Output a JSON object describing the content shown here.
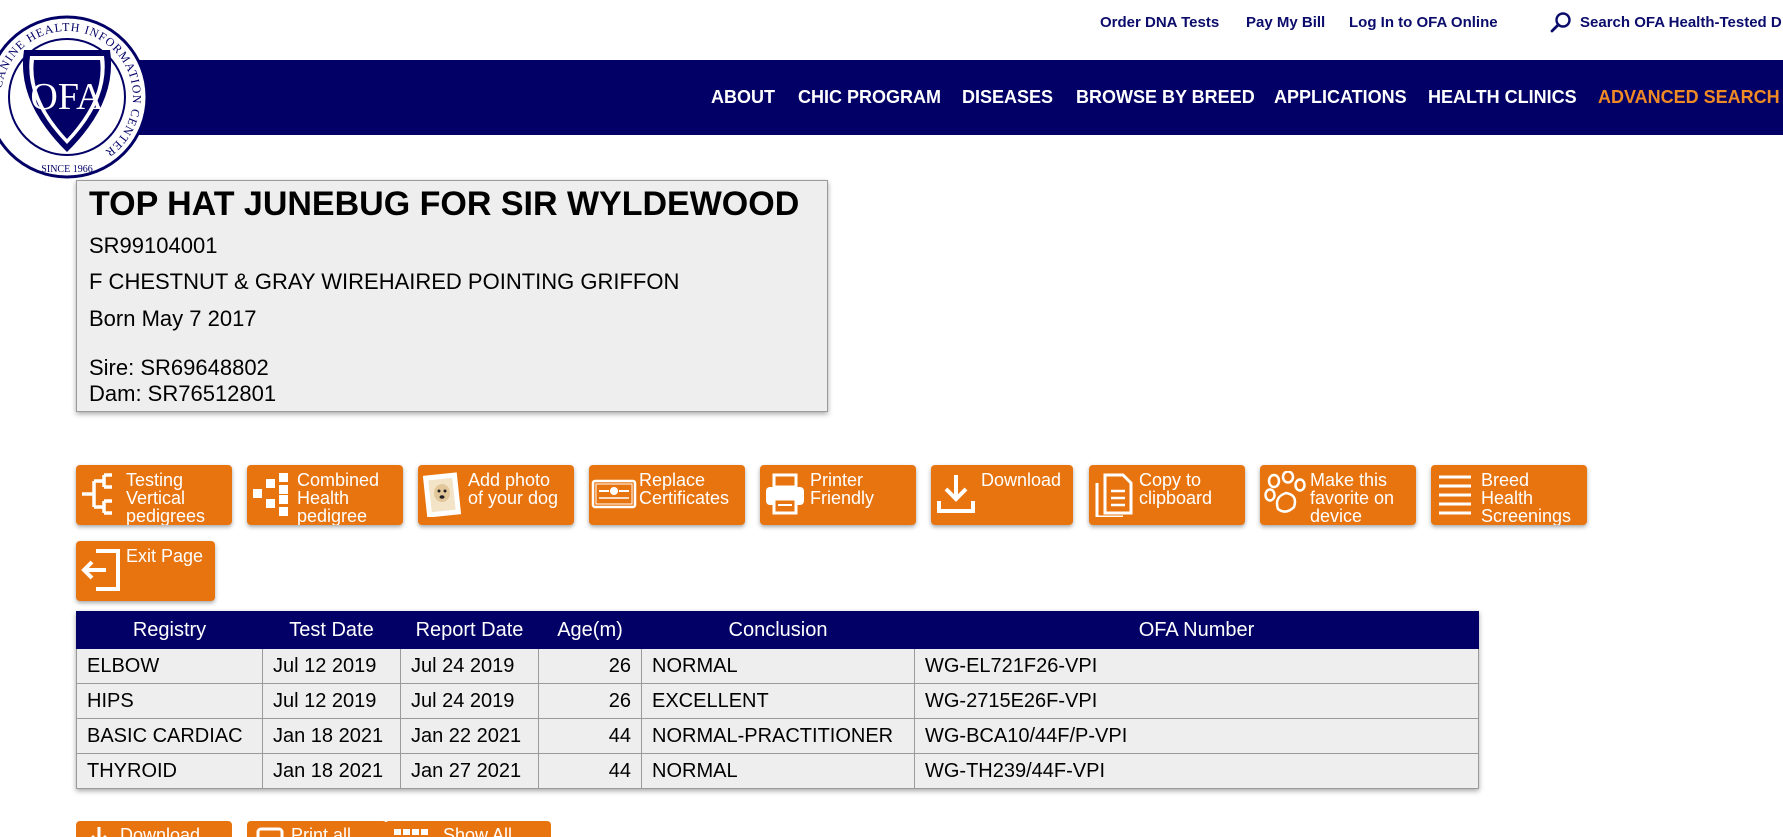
{
  "utility": {
    "order_dna": "Order DNA Tests",
    "pay_bill": "Pay My Bill",
    "login": "Log In to OFA Online",
    "search_label": "Search OFA Health-Tested D"
  },
  "logo": {
    "text": "OFA",
    "ring_text": "CANINE HEALTH INFORMATION CENTER",
    "since": "SINCE 1966"
  },
  "nav": {
    "items": [
      "ABOUT",
      "CHIC PROGRAM",
      "DISEASES",
      "BROWSE BY BREED",
      "APPLICATIONS",
      "HEALTH CLINICS",
      "ADVANCED SEARCH"
    ],
    "active": "ADVANCED SEARCH",
    "active_color": "#f08a24"
  },
  "dog": {
    "name": "TOP HAT JUNEBUG FOR SIR WYLDEWOOD",
    "registration": "SR99104001",
    "description": "F CHESTNUT & GRAY WIREHAIRED POINTING GRIFFON",
    "born": "Born May 7 2017",
    "sire": "Sire: SR69648802",
    "dam": "Dam: SR76512801"
  },
  "actions": [
    {
      "label": "Testing\nVertical\npedigrees",
      "icon": "pedigree-tree-icon"
    },
    {
      "label": "Combined\nHealth\npedigree",
      "icon": "combined-pedigree-icon"
    },
    {
      "label": "Add photo\nof your dog",
      "icon": "dog-photo-icon"
    },
    {
      "label": "Replace\nCertificates",
      "icon": "certificate-icon"
    },
    {
      "label": "Printer\nFriendly",
      "icon": "printer-icon"
    },
    {
      "label": "Download",
      "icon": "download-icon"
    },
    {
      "label": "Copy to\nclipboard",
      "icon": "clipboard-icon"
    },
    {
      "label": "Make this\nfavorite on\ndevice",
      "icon": "paw-icon"
    },
    {
      "label": "Breed\nHealth\nScreenings",
      "icon": "list-icon"
    },
    {
      "label": "Exit Page",
      "icon": "exit-icon"
    }
  ],
  "table": {
    "headers": [
      "Registry",
      "Test Date",
      "Report Date",
      "Age(m)",
      "Conclusion",
      "OFA Number"
    ],
    "rows": [
      [
        "ELBOW",
        "Jul 12 2019",
        "Jul 24 2019",
        "26",
        "NORMAL",
        "WG-EL721F26-VPI"
      ],
      [
        "HIPS",
        "Jul 12 2019",
        "Jul 24 2019",
        "26",
        "EXCELLENT",
        "WG-2715E26F-VPI"
      ],
      [
        "BASIC CARDIAC",
        "Jan 18 2021",
        "Jan 22 2021",
        "44",
        "NORMAL-PRACTITIONER",
        "WG-BCA10/44F/P-VPI"
      ],
      [
        "THYROID",
        "Jan 18 2021",
        "Jan 27 2021",
        "44",
        "NORMAL",
        "WG-TH239/44F-VPI"
      ]
    ]
  },
  "bottom_actions": [
    {
      "label": "Download",
      "icon": "download-icon"
    },
    {
      "label": "Print all",
      "icon": "printer-icon"
    },
    {
      "label": "Show All",
      "icon": "grid-icon"
    }
  ],
  "colors": {
    "navy": "#020066",
    "orange": "#e8740f",
    "link_blue": "#0b0c6b",
    "card_bg": "#eeeeee"
  }
}
